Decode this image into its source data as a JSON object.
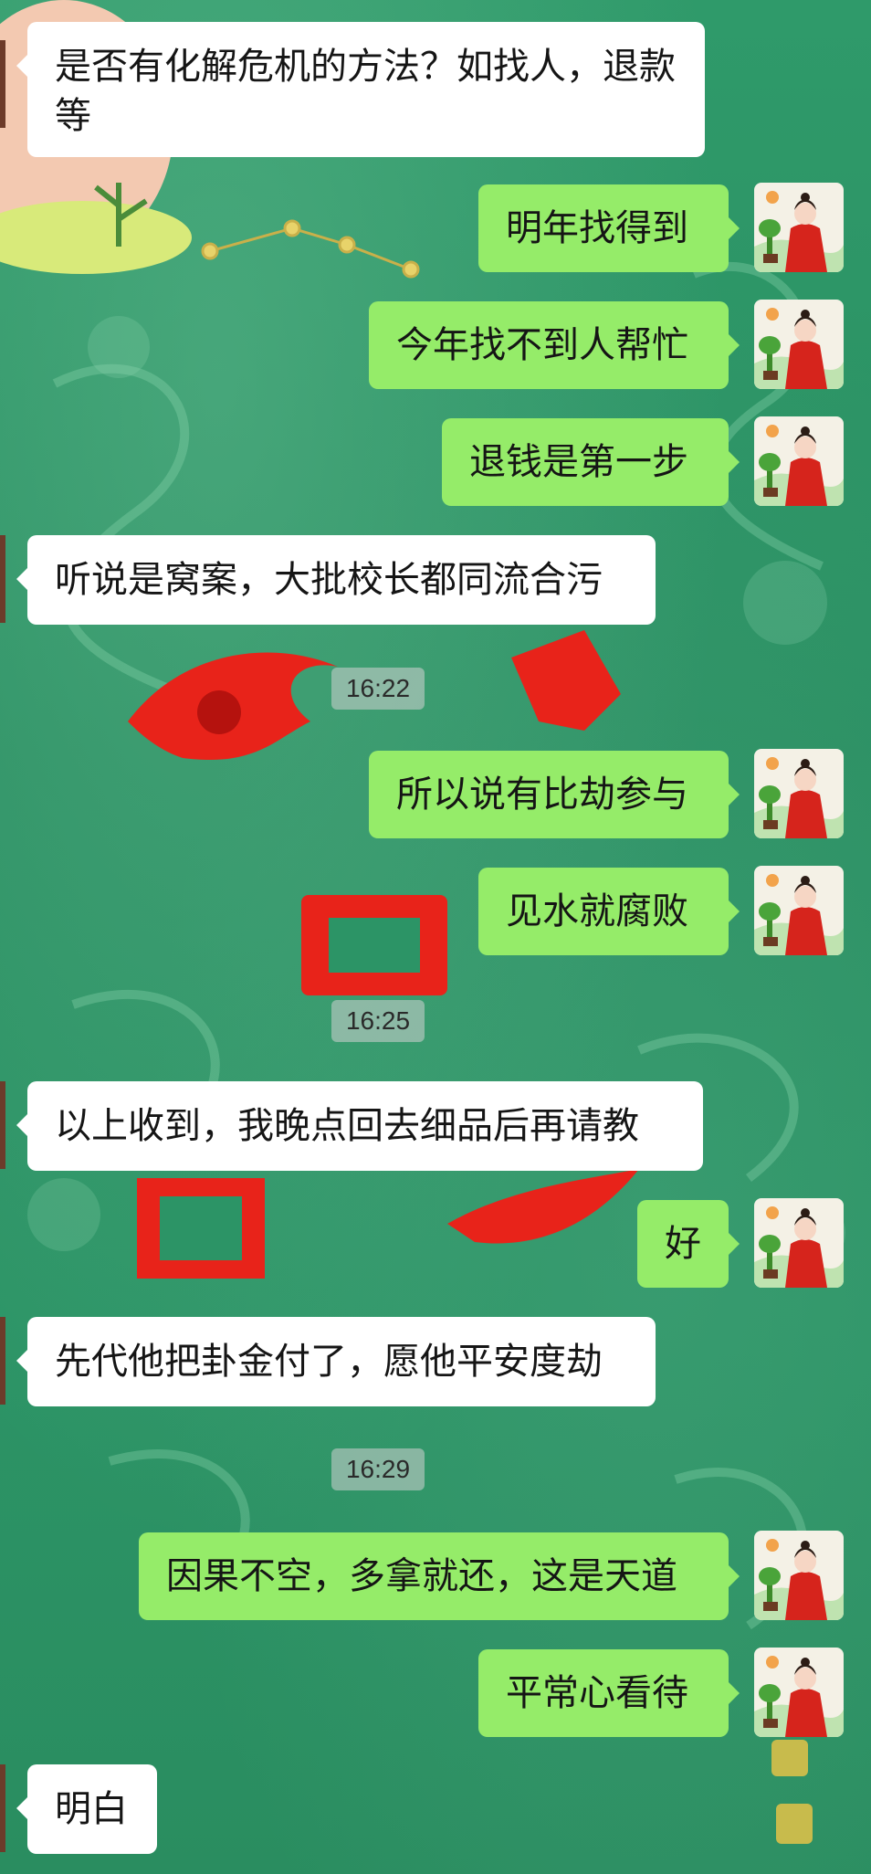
{
  "chat": {
    "timestamps": [
      "16:22",
      "16:25",
      "16:29"
    ],
    "messages": [
      {
        "side": "in",
        "text": "是否有化解危机的方法？如找人，退款等"
      },
      {
        "side": "out",
        "text": "明年找得到"
      },
      {
        "side": "out",
        "text": "今年找不到人帮忙"
      },
      {
        "side": "out",
        "text": "退钱是第一步"
      },
      {
        "side": "in",
        "text": "听说是窝案，大批校长都同流合污"
      },
      {
        "side": "out",
        "text": "所以说有比劫参与"
      },
      {
        "side": "out",
        "text": "见水就腐败"
      },
      {
        "side": "in",
        "text": "以上收到，我晚点回去细品后再请教"
      },
      {
        "side": "out",
        "text": "好"
      },
      {
        "side": "in",
        "text": "先代他把卦金付了，愿他平安度劫"
      },
      {
        "side": "out",
        "text": "因果不空，多拿就还，这是天道"
      },
      {
        "side": "out",
        "text": "平常心看待"
      },
      {
        "side": "in",
        "text": "明白"
      }
    ]
  },
  "colors": {
    "background": "#2c9466",
    "incoming_bubble": "#ffffff",
    "outgoing_bubble": "#95ec69",
    "timestamp_bg": "#d2d2d2",
    "decor_red": "#e8231a"
  },
  "avatar": {
    "icon": "woman-in-red-hanfu-avatar"
  }
}
